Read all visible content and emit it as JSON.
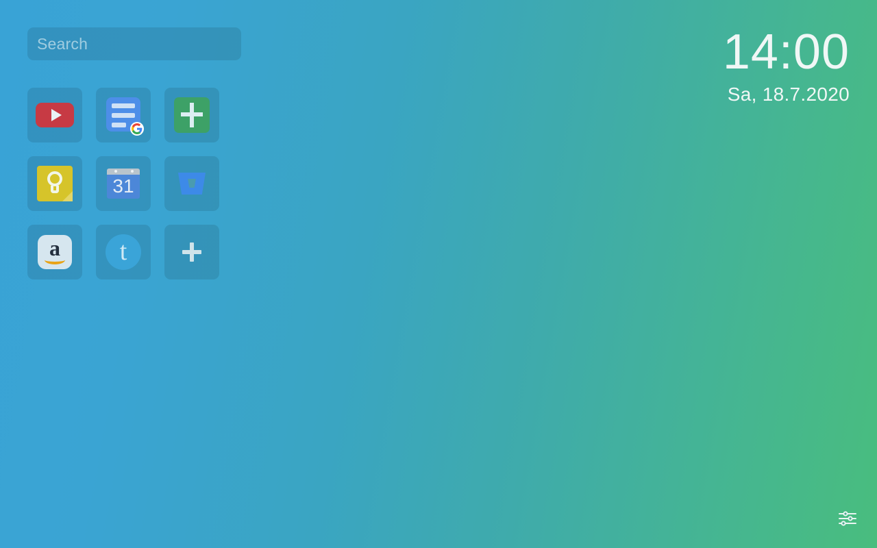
{
  "page": {
    "title": "New Tab",
    "background_start": "#39a3d6",
    "background_end": "#49bd7e"
  },
  "search": {
    "placeholder": "Search",
    "value": ""
  },
  "clock": {
    "time": "14:00",
    "date": "Sa, 18.7.2020"
  },
  "apps": [
    {
      "label": "YouTube",
      "icon": "youtube-icon",
      "color": "#c73a44"
    },
    {
      "label": "Google Docs",
      "icon": "google-docs-icon",
      "color": "#4d8ee8",
      "badge": "G"
    },
    {
      "label": "Google Sheets",
      "icon": "sheets-plus-icon",
      "color": "#3da167"
    },
    {
      "label": "Google Keep",
      "icon": "google-keep-icon",
      "color": "#d6c42a"
    },
    {
      "label": "Google Calendar",
      "icon": "calendar-icon",
      "color": "#4c87d8",
      "day": "31"
    },
    {
      "label": "Bitbucket",
      "icon": "bitbucket-icon",
      "color": "#3d8ae8"
    },
    {
      "label": "Amazon",
      "icon": "amazon-icon",
      "color": "#d6e6ef"
    },
    {
      "label": "Tumblr",
      "icon": "tumblr-icon",
      "color": "#3aa4d8",
      "letter": "t"
    },
    {
      "label": "Add shortcut",
      "icon": "add-plus-icon",
      "color": "#cfe3ea"
    }
  ],
  "settings": {
    "label": "Settings",
    "icon": "sliders-icon"
  }
}
